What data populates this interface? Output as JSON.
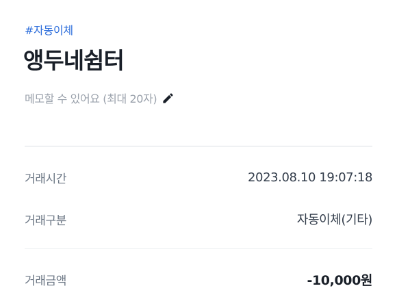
{
  "header": {
    "tag": "#자동이체",
    "title": "앵두네쉼터",
    "memo_placeholder": "메모할 수 있어요 (최대 20자)",
    "memo_icon": "pencil-icon"
  },
  "details": [
    {
      "label": "거래시간",
      "value": "2023.08.10 19:07:18"
    },
    {
      "label": "거래구분",
      "value": "자동이체(기타)"
    },
    {
      "label": "거래금액",
      "value": "-10,000원"
    }
  ],
  "colors": {
    "accent": "#2f6fdc",
    "text_primary": "#191f28",
    "text_secondary": "#6b7684",
    "placeholder": "#9aa1ab"
  }
}
